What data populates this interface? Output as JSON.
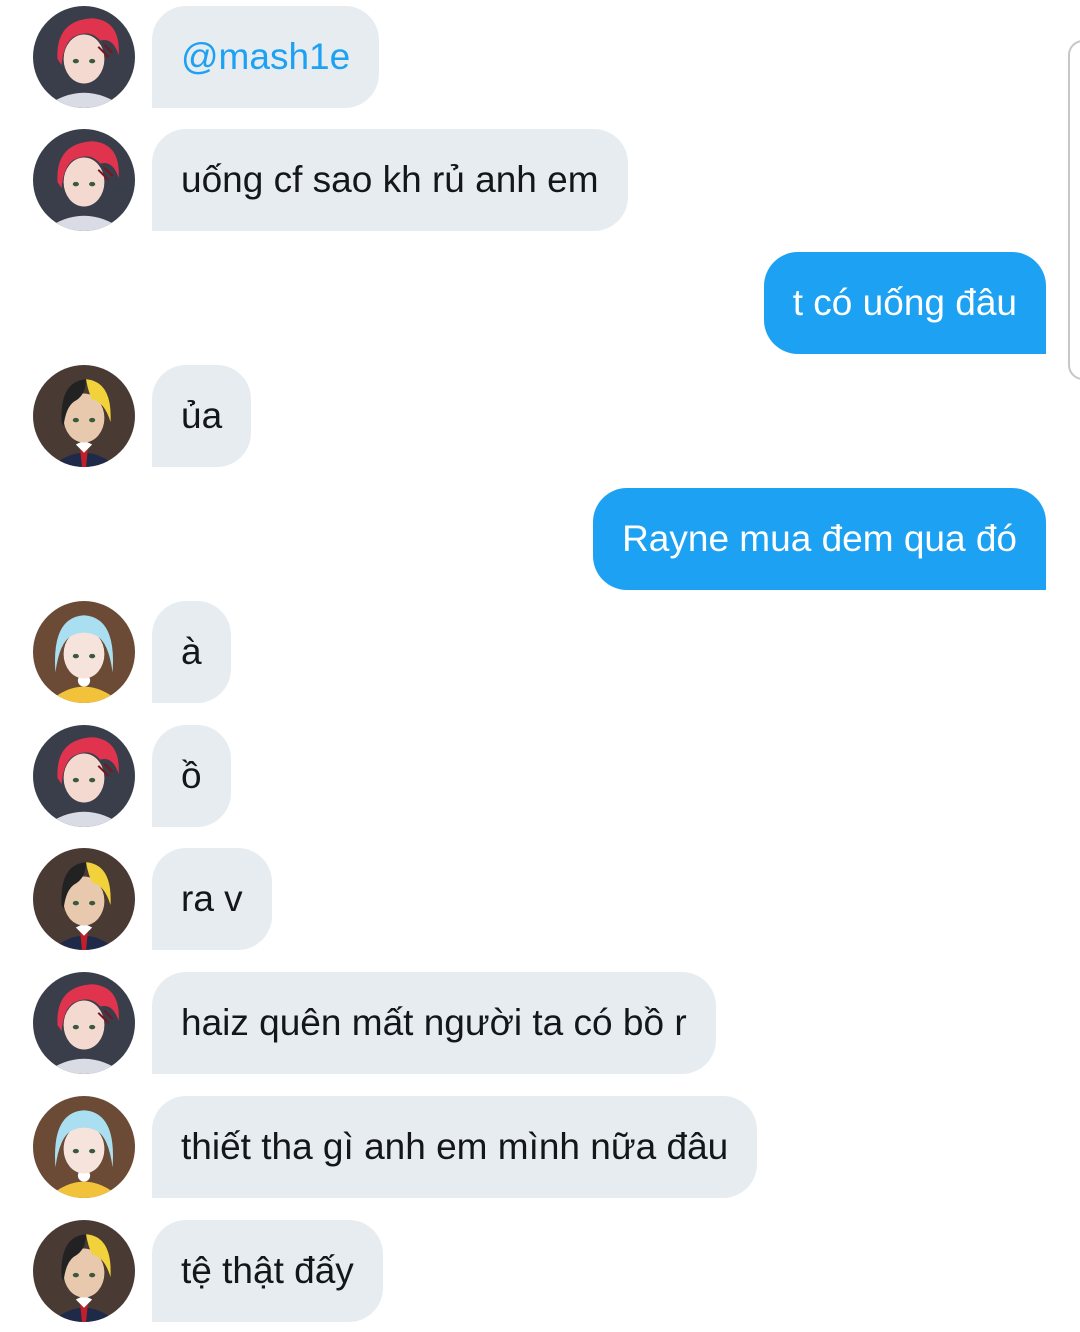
{
  "messages": [
    {
      "type": "in",
      "user": "red",
      "text": "@mash1e",
      "mention": true
    },
    {
      "type": "in",
      "user": "red",
      "text": "uống cf sao kh rủ anh em"
    },
    {
      "type": "out",
      "text": "t có uống đâu"
    },
    {
      "type": "in",
      "user": "dark",
      "text": "ủa"
    },
    {
      "type": "out",
      "text": "Rayne mua đem qua đó"
    },
    {
      "type": "in",
      "user": "blue",
      "text": "à"
    },
    {
      "type": "in",
      "user": "red",
      "text": "ồ"
    },
    {
      "type": "in",
      "user": "dark",
      "text": "ra v"
    },
    {
      "type": "in",
      "user": "red",
      "text": "haiz quên mất người ta có bồ r"
    },
    {
      "type": "in",
      "user": "blue",
      "text": "thiết tha gì anh em mình nữa đâu"
    },
    {
      "type": "in",
      "user": "dark",
      "text": "tệ thật đấy"
    }
  ],
  "avatars": {
    "red": {
      "icon": "red-haired-avatar",
      "hair": "#e0334e",
      "bg": "#3a3e4a",
      "skin": "#f3d9cf"
    },
    "dark": {
      "icon": "dark-haired-avatar",
      "hair": "#222222",
      "streak": "#f2d23a",
      "bg": "#4a3a34",
      "skin": "#e8c9ad",
      "suit": "#1f2a4a"
    },
    "blue": {
      "icon": "blue-haired-avatar",
      "hair": "#a9dff0",
      "bg": "#6b4a36",
      "skin": "#f6e4dc",
      "dress": "#f2c23a"
    }
  },
  "colors": {
    "incoming_bg": "#e6ecf0",
    "outgoing_bg": "#1da1f2",
    "mention": "#1da1f2"
  }
}
